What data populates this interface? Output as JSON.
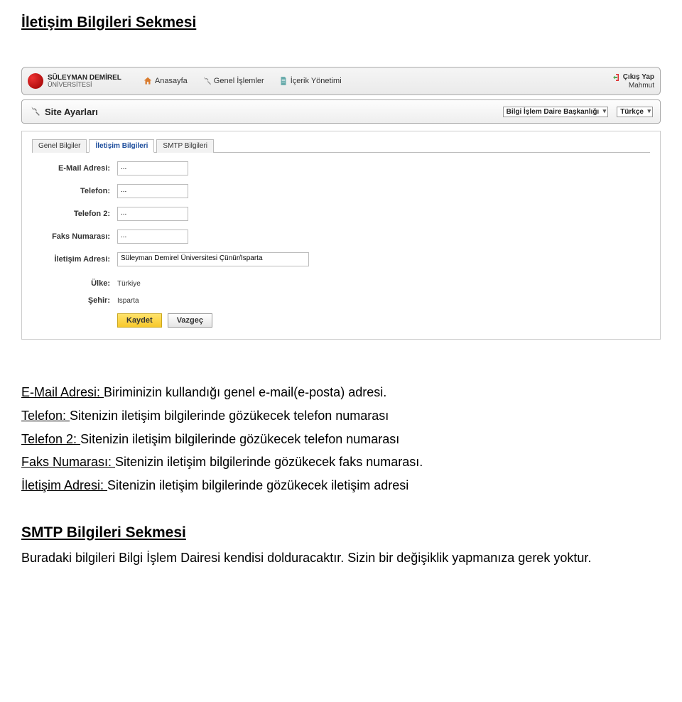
{
  "doc_title": "İletişim Bilgileri Sekmesi",
  "header": {
    "uni_name": "SÜLEYMAN DEMİREL",
    "uni_sub": "ÜNİVERSİTESİ",
    "nav": [
      {
        "label": "Anasayfa"
      },
      {
        "label": "Genel İşlemler"
      },
      {
        "label": "İçerik Yönetimi"
      }
    ],
    "logout": "Çıkış Yap",
    "user": "Mahmut"
  },
  "panel": {
    "title": "Site Ayarları",
    "select1": "Bilgi İşlem Daire Başkanlığı",
    "select2": "Türkçe"
  },
  "tabs": {
    "genel": "Genel Bilgiler",
    "iletisim": "İletişim Bilgileri",
    "smtp": "SMTP Bilgileri"
  },
  "form": {
    "email_label": "E-Mail Adresi:",
    "email_value": "...",
    "tel_label": "Telefon:",
    "tel_value": "...",
    "tel2_label": "Telefon 2:",
    "tel2_value": "...",
    "faks_label": "Faks Numarası:",
    "faks_value": "...",
    "adres_label": "İletişim Adresi:",
    "adres_value": "Süleyman Demirel Üniversitesi Çünür/Isparta",
    "ulke_label": "Ülke:",
    "ulke_value": "Türkiye",
    "sehir_label": "Şehir:",
    "sehir_value": "Isparta",
    "save": "Kaydet",
    "cancel": "Vazgeç"
  },
  "descriptions": {
    "email_t": "E-Mail Adresi: ",
    "email_d": "Biriminizin kullandığı genel e-mail(e-posta) adresi.",
    "tel_t": "Telefon: ",
    "tel_d": "Sitenizin iletişim bilgilerinde gözükecek telefon numarası",
    "tel2_t": "Telefon 2: ",
    "tel2_d": "Sitenizin iletişim bilgilerinde gözükecek telefon numarası",
    "faks_t": "Faks Numarası: ",
    "faks_d": "Sitenizin iletişim bilgilerinde gözükecek faks numarası.",
    "adres_t": "İletişim Adresi: ",
    "adres_d": "Sitenizin iletişim bilgilerinde gözükecek iletişim adresi"
  },
  "smtp_section": {
    "title": "SMTP Bilgileri Sekmesi",
    "body": "Buradaki bilgileri Bilgi İşlem Dairesi kendisi dolduracaktır. Sizin bir değişiklik yapmanıza gerek yoktur."
  }
}
